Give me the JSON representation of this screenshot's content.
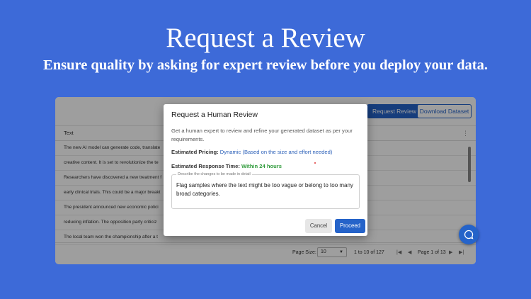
{
  "hero": {
    "title": "Request a Review",
    "subtitle": "Ensure quality by asking for expert review before you deploy your data."
  },
  "toolbar": {
    "request_label": "Request Review",
    "download_label": "Download Dataset"
  },
  "grid": {
    "column_header": "Text",
    "menu_icon": "⋮",
    "rows": [
      "The new AI model can generate code, translate",
      "creative content. It is set to revolutionize the te",
      "Researchers have discovered a new treatment f",
      "early clinical trials. This could be a major breakt",
      "The president announced new economic polici",
      "reducing inflation. The opposition party criticiz",
      "The local team won the championship after a t"
    ]
  },
  "pager": {
    "page_size_label": "Page Size:",
    "page_size_value": "10",
    "range_text": "1 to 10 of 127",
    "first_icon": "|◀",
    "prev_icon": "◀",
    "page_info": "Page 1 of 13",
    "next_icon": "▶",
    "last_icon": "▶|"
  },
  "dialog": {
    "title": "Request a Human Review",
    "intro": "Get a human expert to review and refine your generated dataset as per your requirements.",
    "pricing_label": "Estimated Pricing:",
    "pricing_value": "Dynamic (Based on the size and effort needed)",
    "response_label": "Estimated Response Time:",
    "response_value": "Within 24 hours",
    "field_label": "Describe the changes to be made in detail",
    "field_value": "Flag samples where the text might be too vague or belong to too many broad categories.",
    "cancel_label": "Cancel",
    "proceed_label": "Proceed"
  },
  "icons": {
    "chat": "chat-bubble-icon",
    "caret": "caret-down-icon"
  },
  "colors": {
    "background": "#3d6ad8",
    "accent": "#2563c9",
    "pricing": "#2a5fb8",
    "response": "#2e9a3a"
  }
}
